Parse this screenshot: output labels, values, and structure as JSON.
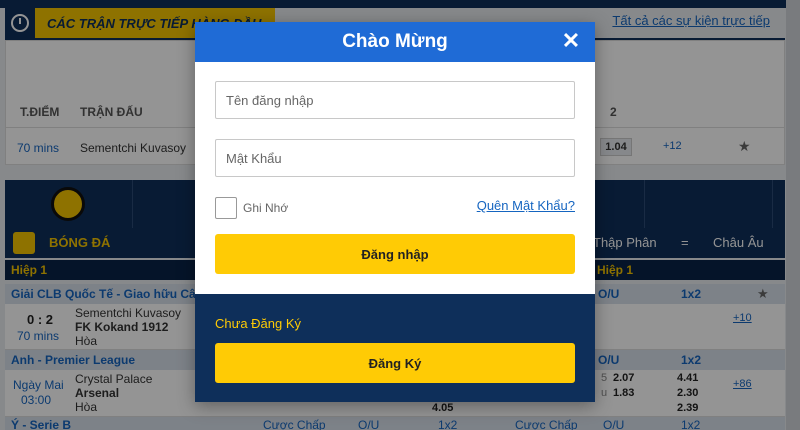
{
  "background": {
    "live_title": "CÁC TRẬN TRỰC TIẾP HÀNG ĐẦU",
    "all_live_link": "Tất cả các sự kiện trực tiếp",
    "col_time": "T.ĐIỂM",
    "col_match": "TRẬN ĐẤU",
    "col_two": "2",
    "top_match": {
      "time": "70 mins",
      "name": "Sementchi Kuvasoy",
      "odd": "1.04",
      "more": "+12"
    },
    "sport_label": "BÓNG ĐÁ",
    "odds_format": "Thập Phân",
    "equals": "=",
    "region": "Châu Âu",
    "half_label": "Hiệp 1",
    "groups": [
      {
        "name": "Giải CLB Quốc Tế - Giao hữu Câu L",
        "ou": "O/U",
        "x2": "1x2"
      },
      {
        "name": "Anh - Premier League",
        "ou": "O/U",
        "x2": "1x2"
      }
    ],
    "match1": {
      "score": "0 : 2",
      "time": "70 mins",
      "home": "Sementchi Kuvasoy",
      "away": "FK Kokand 1912",
      "draw": "Hòa",
      "more": "+10"
    },
    "match2": {
      "date": "Ngày Mai",
      "time": "03:00",
      "home": "Crystal Palace",
      "away": "Arsenal",
      "draw": "Hòa",
      "ou1_label": "5",
      "ou1": "2.07",
      "ou2_label": "u",
      "ou2": "1.83",
      "x1": "4.41",
      "x2": "2.30",
      "x3": "2.39",
      "draw_odd": "4.05",
      "more": "+86"
    },
    "last_group": {
      "name": "Ý - Serie B",
      "c1": "Cược Chấp",
      "o1": "O/U",
      "x1": "1x2",
      "c2": "Cược Chấp",
      "o2": "O/U",
      "x2": "1x2"
    }
  },
  "modal": {
    "title": "Chào Mừng",
    "close_glyph": "✕",
    "username_placeholder": "Tên đăng nhập",
    "password_placeholder": "Mật Khẩu",
    "remember_label": "Ghi Nhớ",
    "forgot_link": "Quên Mật Khẩu?",
    "login_button": "Đăng nhập",
    "no_account_text": "Chưa Đăng Ký",
    "register_button": "Đăng Ký"
  },
  "colors": {
    "header_blue": "#1f6bd6",
    "navy": "#0e2f5a",
    "yellow": "#ffcb05"
  }
}
